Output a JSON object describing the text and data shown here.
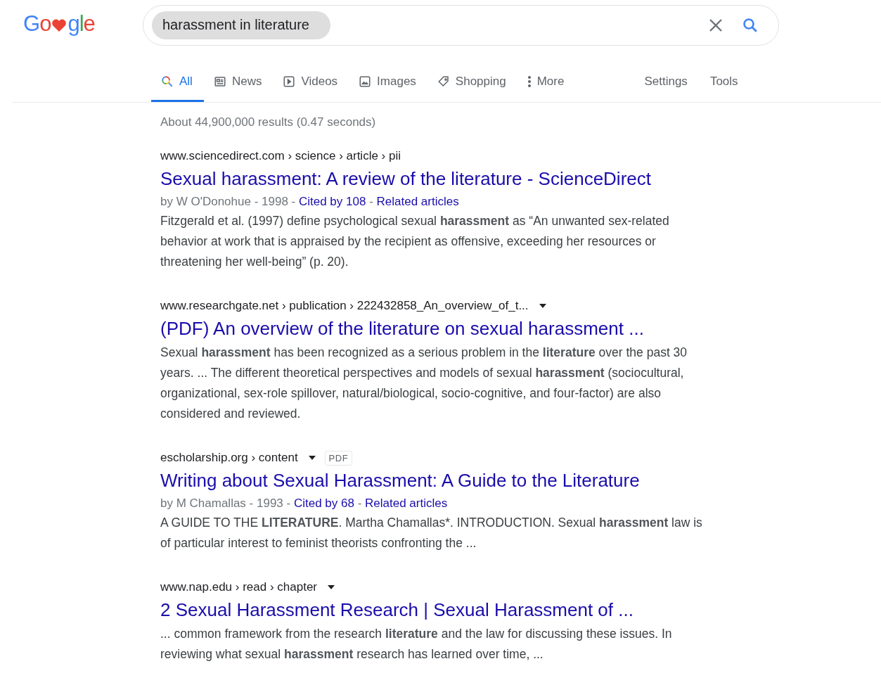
{
  "logo": {
    "letters": [
      {
        "kind": "letter",
        "text": "G",
        "color": "#4285f4"
      },
      {
        "kind": "letter",
        "text": "o",
        "color": "#ea4335"
      },
      {
        "kind": "heart",
        "color": "#ea4335"
      },
      {
        "kind": "letter",
        "text": "g",
        "color": "#4285f4"
      },
      {
        "kind": "letter",
        "text": "l",
        "color": "#34a853"
      },
      {
        "kind": "letter",
        "text": "e",
        "color": "#ea4335"
      }
    ]
  },
  "search": {
    "value": "harassment in literature"
  },
  "tabs": [
    {
      "kind": "all",
      "label": "All",
      "selected": true
    },
    {
      "kind": "news",
      "label": "News",
      "selected": false
    },
    {
      "kind": "videos",
      "label": "Videos",
      "selected": false
    },
    {
      "kind": "images",
      "label": "Images",
      "selected": false
    },
    {
      "kind": "shopping",
      "label": "Shopping",
      "selected": false
    },
    {
      "kind": "more",
      "label": "More",
      "selected": false
    }
  ],
  "tools": [
    "Settings",
    "Tools"
  ],
  "result_stats": "About 44,900,000 results (0.47 seconds)",
  "results": [
    {
      "url": "www.sciencedirect.com › science › article › pii",
      "dropdown": false,
      "title": "Sexual harassment: A review of the literature - ScienceDirect",
      "byline": "by W O'Donohue - 1998 - ",
      "cited": "Cited by 108",
      "sep": " - ",
      "related": "Related articles",
      "snippet": "Fitzgerald et al. (1997) define psychological sexual **harassment** as “An unwanted sex-related behavior at work that is appraised by the recipient as offensive, exceeding her resources or threatening her well-being” (p. 20)."
    },
    {
      "url": "www.researchgate.net › publication › 222432858_An_overview_of_t...",
      "dropdown": true,
      "title": "(PDF) An overview of the literature on sexual harassment ...",
      "snippet": "Sexual **harassment** has been recognized as a serious problem in the **literature** over the past 30 years. ... The different theoretical perspectives and models of sexual **harassment** (sociocultural, organizational, sex-role spillover, natural/biological, socio-cognitive, and four-factor) are also considered and reviewed."
    },
    {
      "url": "escholarship.org › content",
      "dropdown": true,
      "badge": "PDF",
      "title": "Writing about Sexual Harassment: A Guide to the Literature",
      "byline": "by M Chamallas - 1993 - ",
      "cited": "Cited by 68",
      "sep": " - ",
      "related": "Related articles",
      "snippet": "A GUIDE TO THE **LITERATURE**. Martha Chamallas*. INTRODUCTION. Sexual **harassment** law is of particular interest to feminist theorists confronting the ..."
    },
    {
      "url": "www.nap.edu › read › chapter",
      "dropdown": true,
      "title": "2 Sexual Harassment Research | Sexual Harassment of ...",
      "snippet": "... common framework from the research **literature** and the law for discussing these issues. In reviewing what sexual **harassment** research has learned over time, ..."
    }
  ]
}
